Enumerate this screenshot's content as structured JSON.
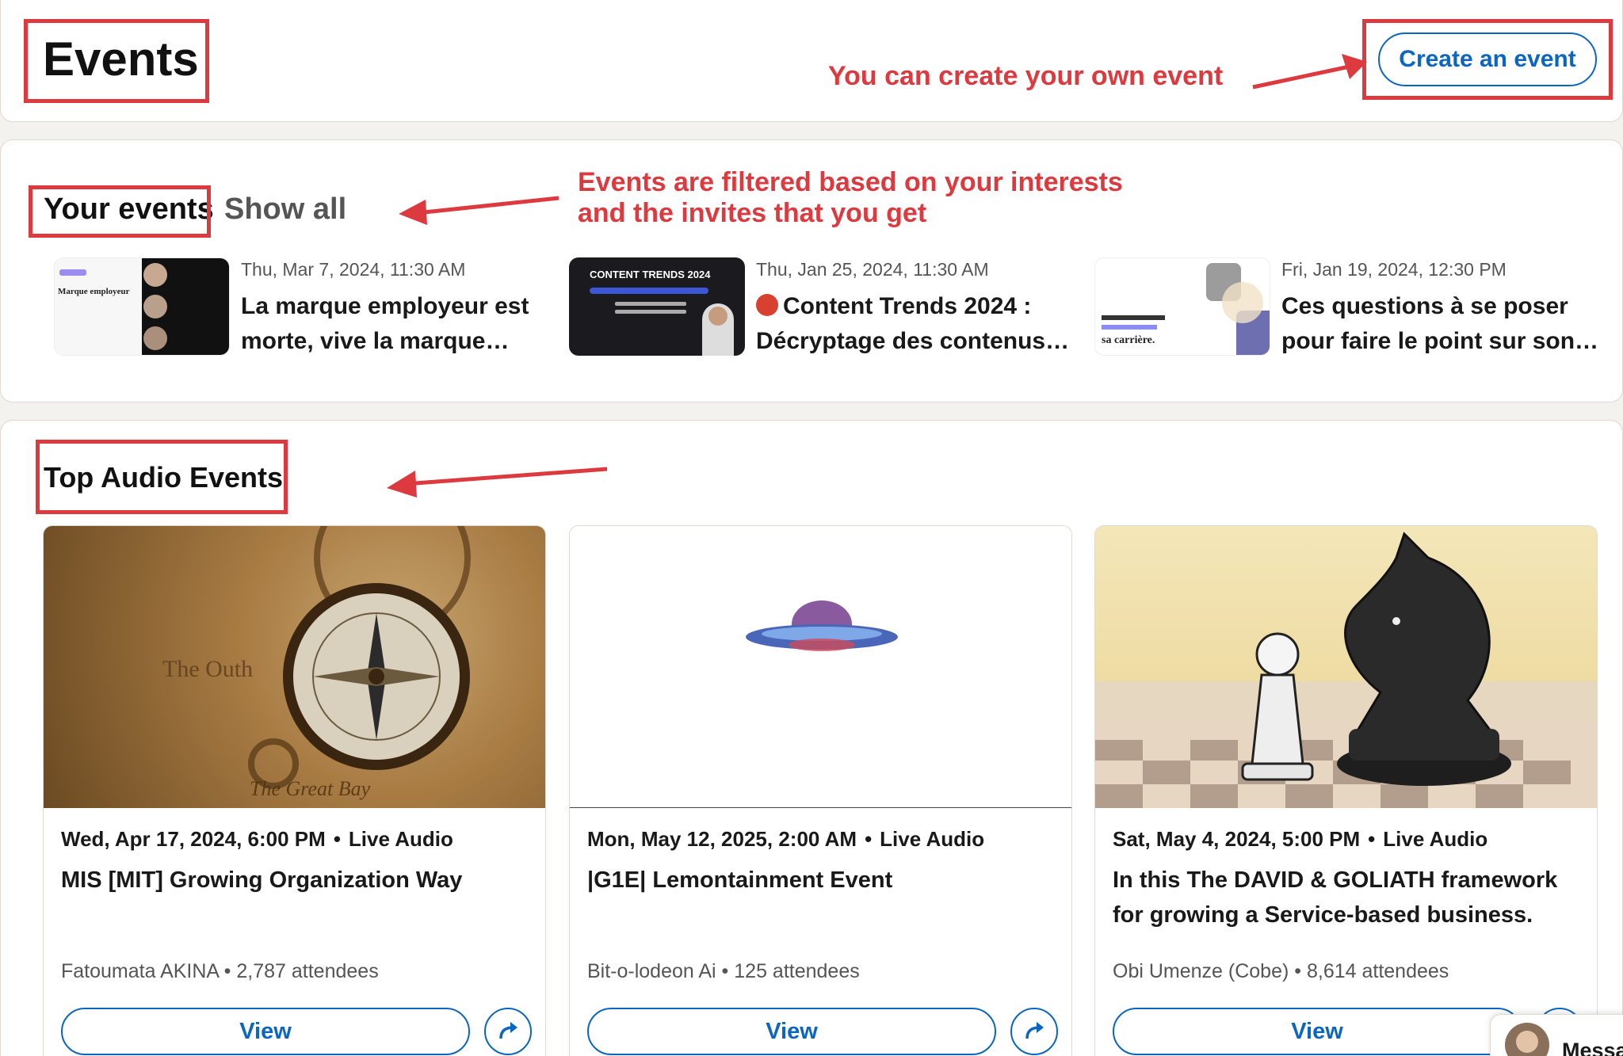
{
  "header": {
    "title": "Events",
    "create_button": "Create an event"
  },
  "annotations": {
    "create": "You can create your own event",
    "filtered_line1": "Events are filtered based on your interests",
    "filtered_line2": "and the invites that you get"
  },
  "your_events": {
    "tab_label": "Your events",
    "show_all": "Show all",
    "items": [
      {
        "date": "Thu, Mar 7, 2024, 11:30 AM",
        "title": "La marque employeur est morte, vive la marque…",
        "thumb_text": "Marque employeur"
      },
      {
        "date": "Thu, Jan 25, 2024, 11:30 AM",
        "title": "Content Trends 2024 : Décryptage des contenus…",
        "thumb_text": "CONTENT TRENDS 2024"
      },
      {
        "date": "Fri, Jan 19, 2024, 12:30 PM",
        "title": "Ces questions à se poser pour faire le point sur son…",
        "thumb_text": "sa carrière."
      }
    ]
  },
  "top_audio": {
    "title": "Top Audio Events",
    "cards": [
      {
        "date": "Wed, Apr 17, 2024, 6:00 PM",
        "type": "Live Audio",
        "title": "MIS [MIT] Growing Organization Way",
        "host": "Fatoumata AKINA",
        "attendees": "2,787 attendees",
        "view": "View",
        "image": "compass-map-image"
      },
      {
        "date": "Mon, May 12, 2025, 2:00 AM",
        "type": "Live Audio",
        "title": "|G1E| Lemontainment Event",
        "host": "Bit-o-lodeon Ai",
        "attendees": "125 attendees",
        "view": "View",
        "image": "ufo-image"
      },
      {
        "date": "Sat, May 4, 2024, 5:00 PM",
        "type": "Live Audio",
        "title": "In this The DAVID & GOLIATH framework for growing a Service-based business.",
        "host": "Obi Umenze (Cobe)",
        "attendees": "8,614 attendees",
        "view": "View",
        "image": "chess-image"
      }
    ]
  },
  "messaging": {
    "label": "Messa"
  },
  "colors": {
    "accent": "#0a66c2",
    "annotation": "#dc3a3f"
  }
}
